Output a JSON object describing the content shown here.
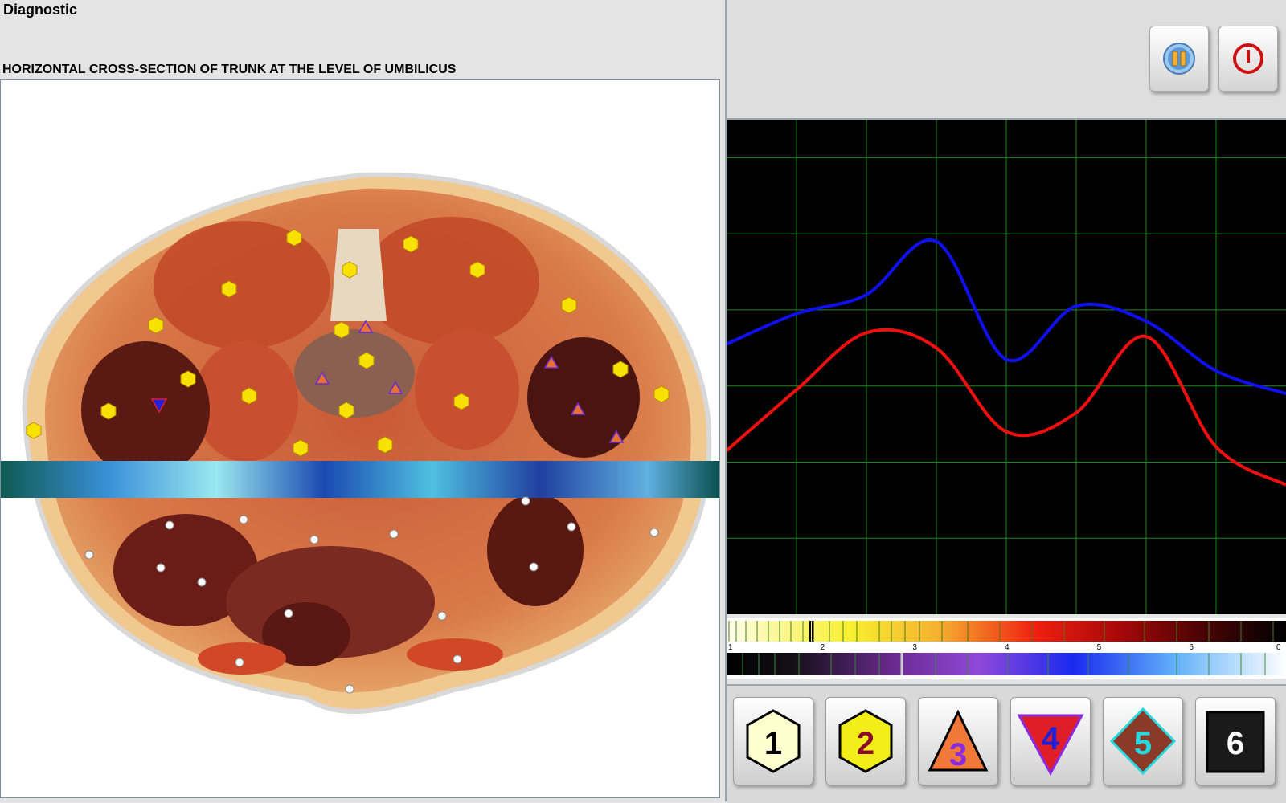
{
  "app": {
    "title": "Diagnostic"
  },
  "section": {
    "title": "HORIZONTAL CROSS-SECTION OF TRUNK AT THE LEVEL OF UMBILICUS"
  },
  "toolbar": {
    "buttons": [
      {
        "name": "pause-icon",
        "color": "#e8a020"
      },
      {
        "name": "power-icon",
        "color": "#d01010"
      }
    ]
  },
  "spectrum": {
    "scale_labels": [
      "1",
      "2",
      "3",
      "4",
      "5",
      "6",
      "0"
    ]
  },
  "shape_buttons": [
    {
      "label": "1",
      "shape": "hexagon",
      "fill": "#ffffd0",
      "text_color": "#000000"
    },
    {
      "label": "2",
      "shape": "hexagon",
      "fill": "#f2ee1a",
      "text_color": "#8b0a2a"
    },
    {
      "label": "3",
      "shape": "triangle",
      "fill": "#f07838",
      "text_color": "#8a2be2"
    },
    {
      "label": "4",
      "shape": "triangle-down",
      "fill": "#e01e28",
      "text_color": "#2020d8"
    },
    {
      "label": "5",
      "shape": "diamond",
      "fill": "#8a3a26",
      "text_color": "#28d8e0"
    },
    {
      "label": "6",
      "shape": "square",
      "fill": "#1a1a1a",
      "text_color": "#ffffff"
    }
  ],
  "chart_data": {
    "type": "line",
    "x": [
      0,
      1,
      2,
      3,
      4,
      5,
      6,
      7,
      8
    ],
    "series": [
      {
        "color": "#1010ee",
        "values": [
          3.55,
          3.95,
          4.2,
          4.9,
          3.35,
          4.05,
          3.85,
          3.2,
          2.9
        ]
      },
      {
        "color": "#ee1010",
        "values": [
          2.15,
          2.95,
          3.7,
          3.5,
          2.4,
          2.65,
          3.65,
          2.2,
          1.7
        ]
      }
    ],
    "ylim": [
      0,
      6.5
    ],
    "grid": true
  }
}
